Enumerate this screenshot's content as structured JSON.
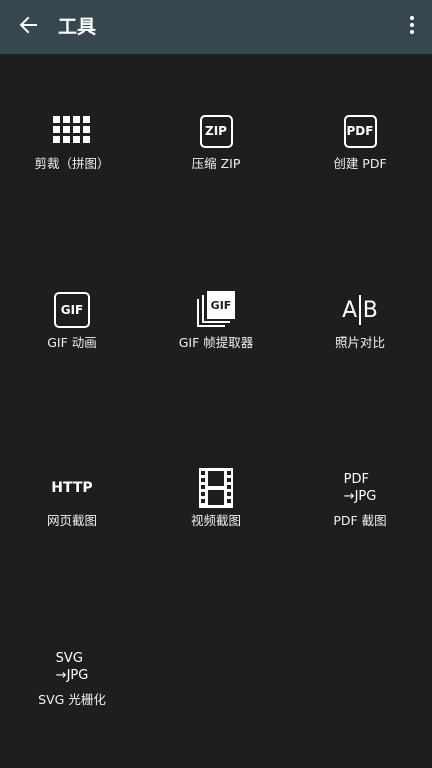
{
  "app_bar": {
    "title": "工具",
    "back_icon": "arrow-back-icon",
    "menu_icon": "more-vert-icon"
  },
  "colors": {
    "app_bar_bg": "#37474f",
    "content_bg": "#1e1e1e",
    "icon": "#ffffff"
  },
  "tools": [
    {
      "label": "剪裁（拼图）",
      "icon": "grid-icon"
    },
    {
      "label": "压缩 ZIP",
      "icon": "zip-icon",
      "icon_text": "ZIP"
    },
    {
      "label": "创建 PDF",
      "icon": "pdf-icon",
      "icon_text": "PDF"
    },
    {
      "label": "GIF 动画",
      "icon": "gif-icon",
      "icon_text": "GIF"
    },
    {
      "label": "GIF 帧提取器",
      "icon": "gif-frames-icon",
      "icon_text": "GIF"
    },
    {
      "label": "照片对比",
      "icon": "compare-icon",
      "icon_text_a": "A",
      "icon_text_b": "B"
    },
    {
      "label": "网页截图",
      "icon": "http-icon",
      "icon_text": "HTTP"
    },
    {
      "label": "视频截图",
      "icon": "film-strip-icon"
    },
    {
      "label": "PDF 截图",
      "icon": "pdf-to-jpg-icon",
      "icon_text_top": "PDF",
      "icon_text_bottom": "→JPG"
    },
    {
      "label": "SVG 光栅化",
      "icon": "svg-to-jpg-icon",
      "icon_text_top": "SVG",
      "icon_text_bottom": "→JPG"
    }
  ]
}
